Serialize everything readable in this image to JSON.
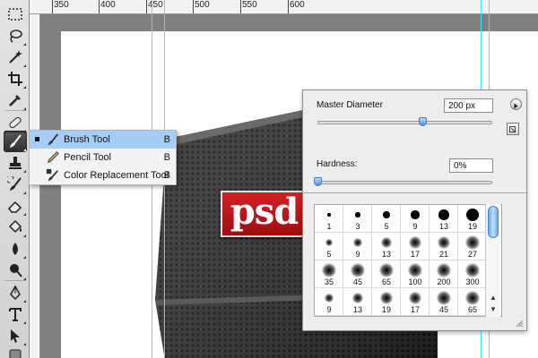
{
  "ruler": {
    "labels": [
      "350",
      "400",
      "450",
      "500",
      "550",
      "600"
    ]
  },
  "tools": [
    "marquee-icon",
    "lasso-icon",
    "magic-wand-icon",
    "crop-icon",
    "eyedropper-icon",
    "healing-icon",
    "brush-icon",
    "clone-stamp-icon",
    "history-brush-icon",
    "eraser-icon",
    "paint-bucket-icon",
    "blur-icon",
    "dodge-icon",
    "pen-icon",
    "type-icon",
    "path-selection-icon",
    "shape-icon"
  ],
  "flyout": {
    "items": [
      {
        "label": "Brush Tool",
        "key": "B",
        "icon": "brush-icon",
        "selected": true
      },
      {
        "label": "Pencil Tool",
        "key": "B",
        "icon": "pencil-icon",
        "selected": false
      },
      {
        "label": "Color Replacement Tool",
        "key": "B",
        "icon": "color-replacement-icon",
        "selected": false
      }
    ]
  },
  "brush_picker": {
    "master_diameter_label": "Master Diameter",
    "master_diameter_value": "200 px",
    "master_diameter_slider": 0.6,
    "hardness_label": "Hardness:",
    "hardness_value": "0%",
    "hardness_slider": 0.0,
    "presets": [
      [
        "1",
        "3",
        "5",
        "9",
        "13",
        "19"
      ],
      [
        "5",
        "9",
        "13",
        "17",
        "21",
        "27"
      ],
      [
        "35",
        "45",
        "65",
        "100",
        "200",
        "300"
      ],
      [
        "9",
        "13",
        "19",
        "17",
        "45",
        "65"
      ]
    ]
  },
  "artwork": {
    "logo_text": "psd"
  },
  "colors": {
    "accent": "#36e8f2",
    "selection": "#a6cdf6",
    "logo": "#c0181c"
  }
}
